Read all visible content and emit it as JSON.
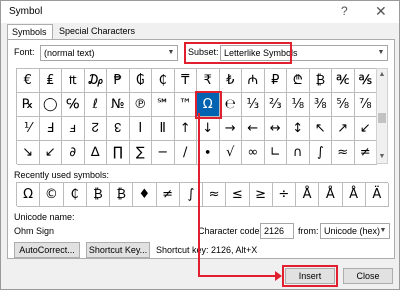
{
  "window": {
    "title": "Symbol",
    "help_glyph": "?",
    "close_glyph": "✕"
  },
  "tabs": [
    {
      "label": "Symbols",
      "active": true
    },
    {
      "label": "Special Characters",
      "active": false
    }
  ],
  "font": {
    "label": "Font:",
    "value": "(normal text)"
  },
  "subset": {
    "label": "Subset:",
    "value": "Letterlike Symbols"
  },
  "symbols": {
    "rows": [
      [
        "€",
        "₤",
        "₶",
        "₯",
        "₱",
        "₲",
        "₵",
        "₸",
        "₹",
        "₺",
        "₼",
        "₽",
        "₾",
        "₿",
        "℀",
        "℁"
      ],
      [
        "℞",
        "◯",
        "℅",
        "ℓ",
        "№",
        "℗",
        "℠",
        "™",
        "Ω",
        "℮",
        "⅓",
        "⅔",
        "⅛",
        "⅜",
        "⅝",
        "⅞"
      ],
      [
        "⅟",
        "Ⅎ",
        "ⅎ",
        "↊",
        "↋",
        "Ⅰ",
        "Ⅱ",
        "↑",
        "↓",
        "→",
        "←",
        "↔",
        "↕",
        "↖",
        "↗",
        "↙"
      ],
      [
        "↘",
        "↙",
        "∂",
        "∆",
        "∏",
        "∑",
        "−",
        "∕",
        "∙",
        "√",
        "∞",
        "∟",
        "∩",
        "∫",
        "≈",
        "≠"
      ]
    ],
    "selected": {
      "row": 1,
      "col": 8
    }
  },
  "recent": {
    "label": "Recently used symbols:",
    "items": [
      "Ω",
      "©",
      "₵",
      "₿",
      "₿",
      "♦",
      "≠",
      "∫",
      "≈",
      "≤",
      "≥",
      "÷",
      "Å",
      "Å",
      "Å",
      "Ä"
    ]
  },
  "unicode": {
    "label": "Unicode name:",
    "name": "Ohm Sign"
  },
  "char_code": {
    "label": "Character code:",
    "value": "2126"
  },
  "from": {
    "label": "from:",
    "value": "Unicode (hex)"
  },
  "buttons": {
    "autocorrect": "AutoCorrect...",
    "shortcut_key": "Shortcut Key...",
    "insert": "Insert",
    "close": "Close"
  },
  "shortcut": {
    "text": "Shortcut key: 2126, Alt+X"
  },
  "highlight_color": "#e0202e",
  "selection_color": "#0063b1"
}
